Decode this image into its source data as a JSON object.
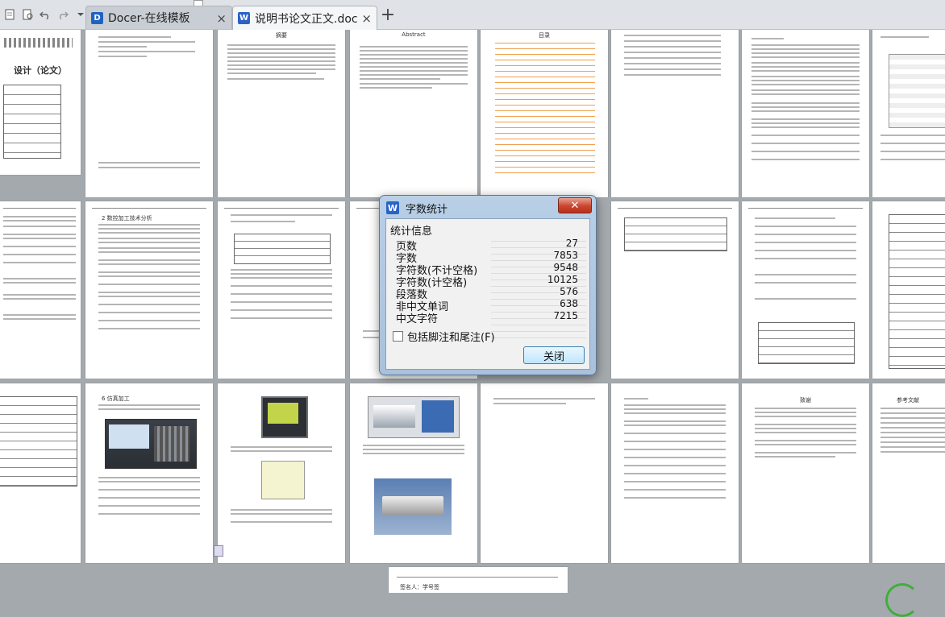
{
  "tabs": [
    {
      "label": "Docer-在线模板",
      "icon": "docer-icon",
      "active": false
    },
    {
      "label": "说明书论文正文.doc",
      "icon": "word-doc-icon",
      "active": true
    }
  ],
  "new_tab_symbol": "+",
  "close_symbol": "×",
  "toolbar_icons": [
    "new-document-icon",
    "preview-icon",
    "undo-icon",
    "redo-icon",
    "dropdown-icon"
  ],
  "pages": {
    "cover_title": "设计（论文）",
    "abstract_cn": "摘要",
    "abstract_en": "Abstract",
    "toc": "目录",
    "section_ch1": "2 数控加工技术分析",
    "section_fig": "6 仿真加工",
    "ack": "致谢",
    "refs": "参考文献",
    "sig": "签名人：学号签"
  },
  "dialog": {
    "title": "字数统计",
    "group_label": "统计信息",
    "stats": [
      {
        "label": "页数",
        "value": "27"
      },
      {
        "label": "字数",
        "value": "7853"
      },
      {
        "label": "字符数(不计空格)",
        "value": "9548"
      },
      {
        "label": "字符数(计空格)",
        "value": "10125"
      },
      {
        "label": "段落数",
        "value": "576"
      },
      {
        "label": "非中文单词",
        "value": "638"
      },
      {
        "label": "中文字符",
        "value": "7215"
      }
    ],
    "checkbox_label": "包括脚注和尾注(F)",
    "checkbox_checked": false,
    "close_button": "关闭",
    "close_x": "✕"
  },
  "colors": {
    "tab_bar": "#dfe3e8",
    "canvas": "#a4a9ad",
    "dialog_frame": "#b0c8e0",
    "close_red": "#c9452f",
    "toc_orange": "#f0a050"
  }
}
